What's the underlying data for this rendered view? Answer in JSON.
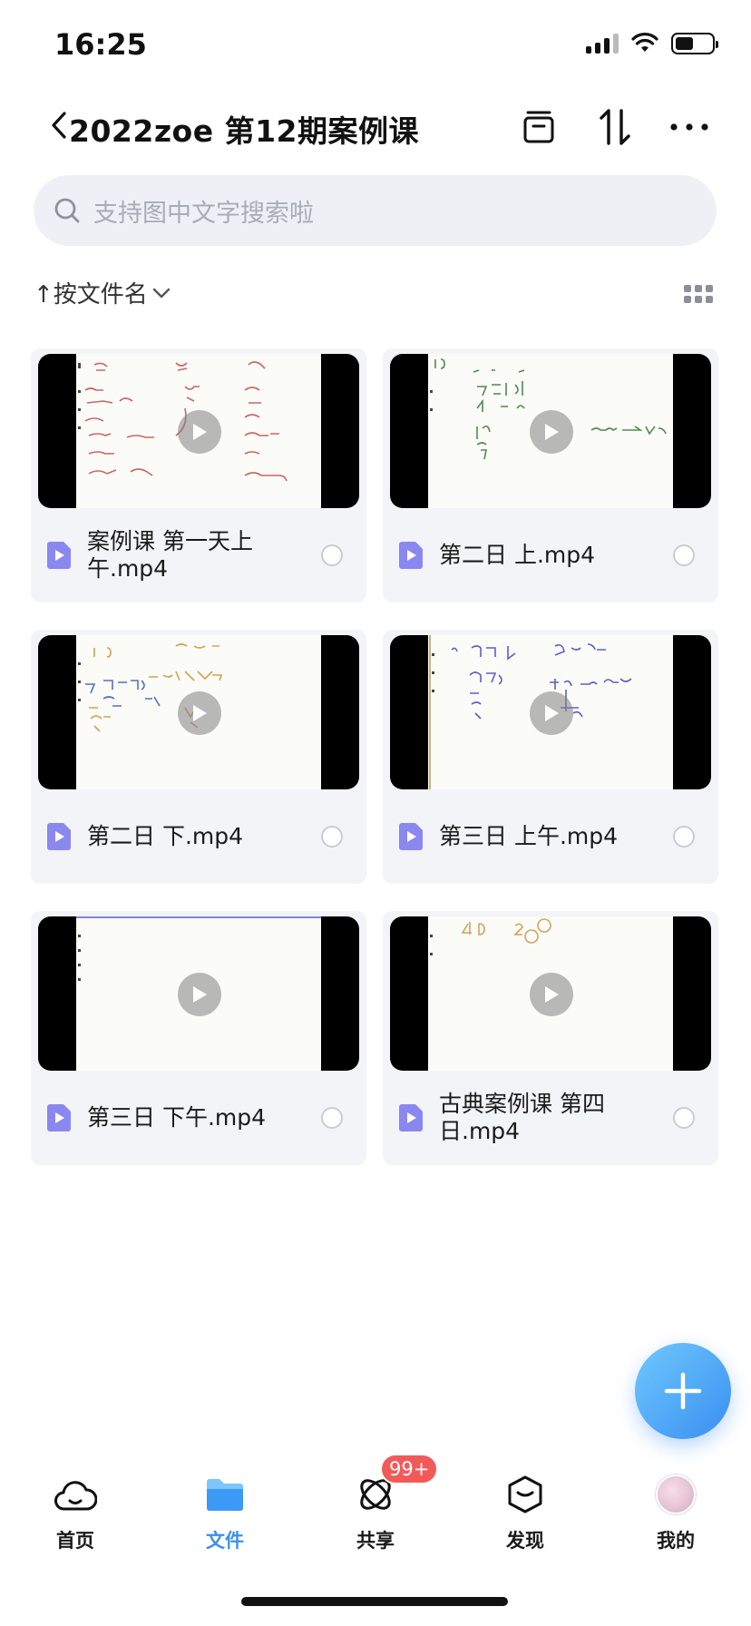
{
  "status_bar": {
    "time": "16:25"
  },
  "header": {
    "title": "2022zoe 第12期案例课"
  },
  "search": {
    "placeholder": "支持图中文字搜索啦"
  },
  "sort": {
    "label": "↑按文件名"
  },
  "files": [
    {
      "name": "案例课 第一天上午.mp4"
    },
    {
      "name": "第二日 上.mp4"
    },
    {
      "name": "第二日 下.mp4"
    },
    {
      "name": "第三日 上午.mp4"
    },
    {
      "name": "第三日 下午.mp4"
    },
    {
      "name": "古典案例课 第四日.mp4"
    }
  ],
  "nav": {
    "items": [
      {
        "label": "首页",
        "icon": "cloud-icon"
      },
      {
        "label": "文件",
        "icon": "folder-icon",
        "active": true
      },
      {
        "label": "共享",
        "icon": "share-icon",
        "badge": "99+"
      },
      {
        "label": "发现",
        "icon": "discover-icon"
      },
      {
        "label": "我的",
        "icon": "avatar"
      }
    ]
  },
  "colors": {
    "accent": "#3a8ff0",
    "badge": "#f25a5a",
    "file_icon": "#8b87f0"
  }
}
